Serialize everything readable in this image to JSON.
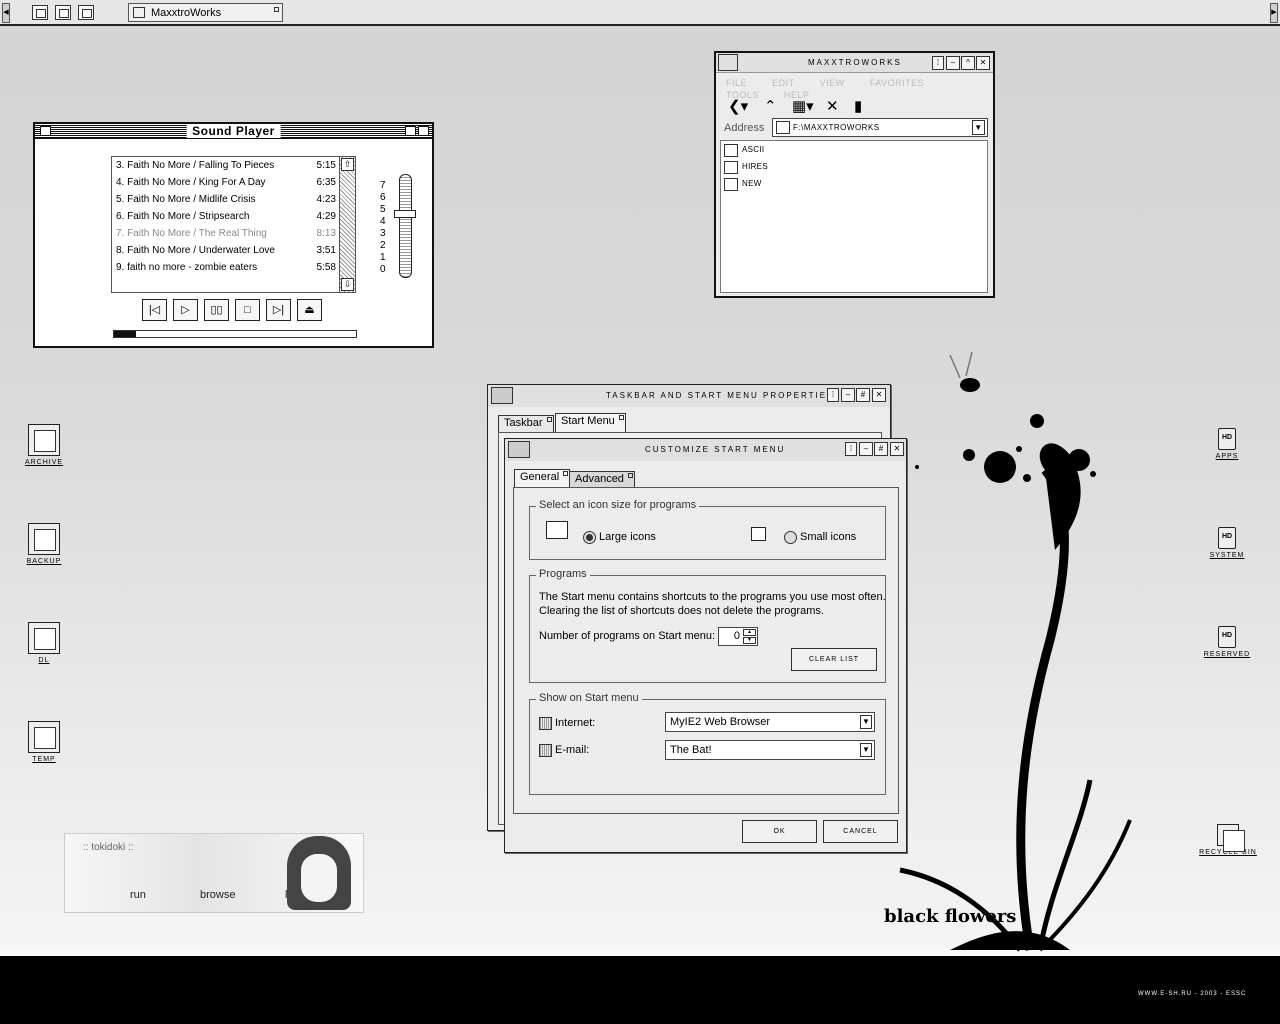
{
  "taskbar": {
    "window_button_label": "MaxxtroWorks",
    "quick_icons": [
      "folder-icon",
      "folder-icon",
      "folder-icon"
    ]
  },
  "sound_player": {
    "title": "Sound Player",
    "playlist": [
      {
        "label": "3. Faith No More / Falling To Pieces",
        "duration": "5:15",
        "dimmed": false
      },
      {
        "label": "4. Faith No More / King For A Day",
        "duration": "6:35",
        "dimmed": false
      },
      {
        "label": "5. Faith No More / Midlife Crisis",
        "duration": "4:23",
        "dimmed": false
      },
      {
        "label": "6. Faith No More / Stripsearch",
        "duration": "4:29",
        "dimmed": false
      },
      {
        "label": "7. Faith No More / The Real Thing",
        "duration": "8:13",
        "dimmed": true
      },
      {
        "label": "8. Faith No More / Underwater Love",
        "duration": "3:51",
        "dimmed": false
      },
      {
        "label": "9. faith no more - zombie eaters",
        "duration": "5:58",
        "dimmed": false
      }
    ],
    "volume_scale": [
      "7",
      "6",
      "5",
      "4",
      "3",
      "2",
      "1",
      "0"
    ],
    "volume_level": 4.5,
    "progress_fraction": 0.09,
    "controls": [
      "prev-icon",
      "play-icon",
      "pause-icon",
      "stop-icon",
      "next-icon",
      "eject-icon"
    ]
  },
  "explorer": {
    "title": "MAXXTROWORKS",
    "menu": [
      "FILE",
      "EDIT",
      "VIEW",
      "FAVORITES",
      "TOOLS",
      "HELP"
    ],
    "address_label": "Address",
    "address_value": "F:\\MAXXTROWORKS",
    "files": [
      "ASCII",
      "HIRES",
      "NEW"
    ]
  },
  "taskbar_properties": {
    "title": "TASKBAR AND START MENU PROPERTIES",
    "tabs": [
      "Taskbar",
      "Start Menu"
    ]
  },
  "customize": {
    "title": "CUSTOMIZE START MENU",
    "tabs": [
      "General",
      "Advanced"
    ],
    "icon_size_group": "Select an icon size for programs",
    "large_icons": "Large icons",
    "small_icons": "Small icons",
    "selected_icon_size": "large",
    "programs_group": "Programs",
    "programs_desc_1": "The Start menu contains shortcuts to the programs you use most often.",
    "programs_desc_2": "Clearing the list of shortcuts does not delete the programs.",
    "num_programs_label": "Number of programs on Start menu:",
    "num_programs_value": "0",
    "clear_list": "CLEAR LIST",
    "show_group": "Show on Start menu",
    "internet_label": "Internet:",
    "internet_value": "MyIE2 Web Browser",
    "email_label": "E-mail:",
    "email_value": "The Bat!",
    "ok": "OK",
    "cancel": "CANCEL"
  },
  "desktop_icons_left": [
    "ARCHIVE",
    "BACKUP",
    "DL",
    "TEMP"
  ],
  "desktop_icons_right": [
    "APPS",
    "SYSTEM",
    "RESERVED",
    "RECYCLE BIN"
  ],
  "tokidoki": {
    "title": ":: tokidoki ::",
    "links": [
      "run",
      "browse",
      "leave"
    ]
  },
  "wallpaper": {
    "caption": "black flowers",
    "credit": "WWW.E-SH.RU - 2003 - ESSC"
  }
}
